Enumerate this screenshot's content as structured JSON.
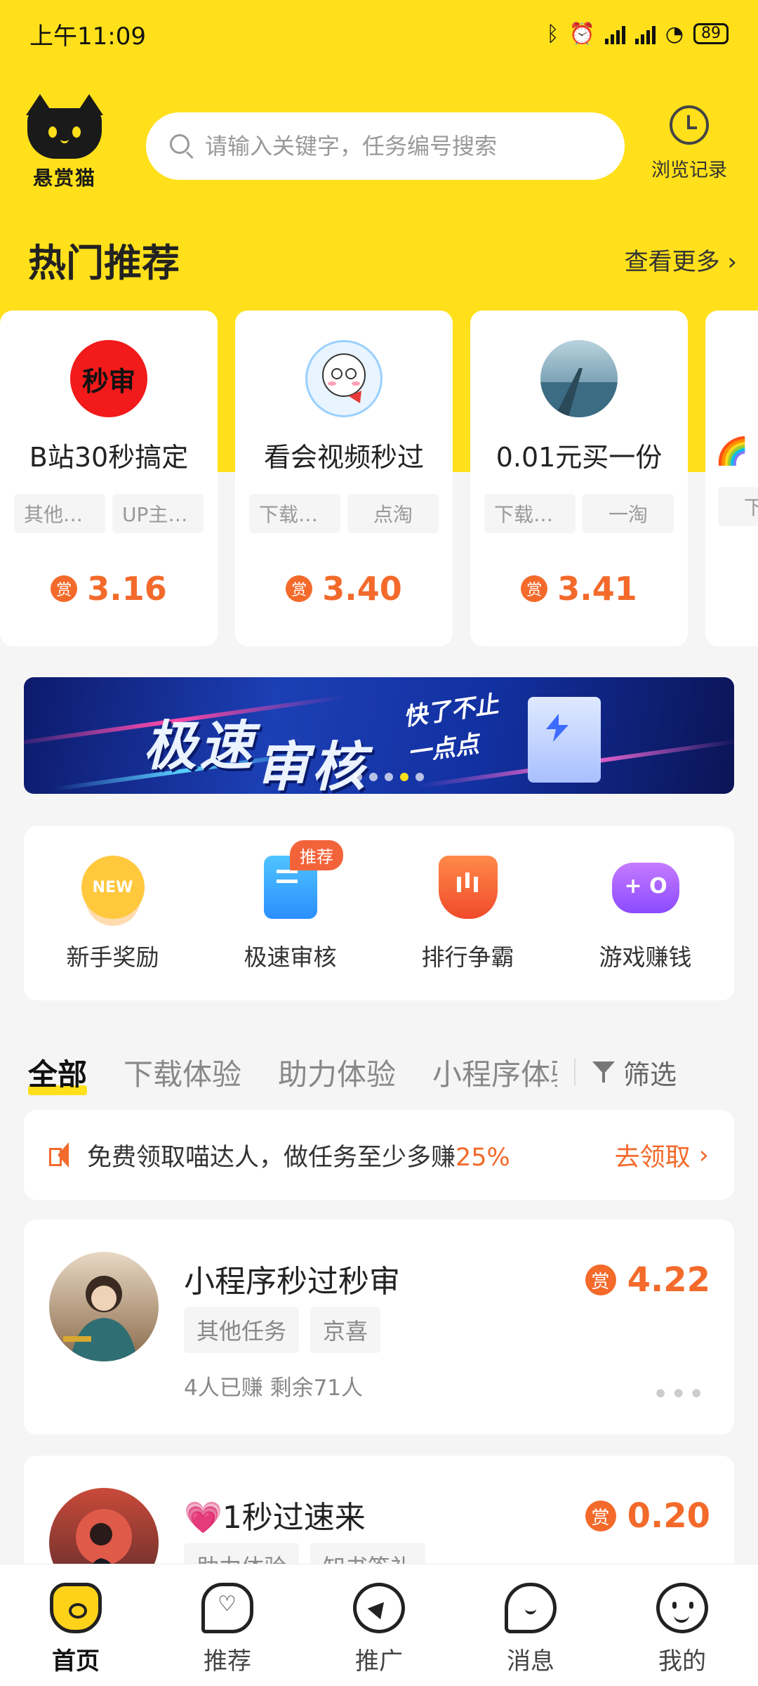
{
  "status": {
    "time": "上午11:09",
    "battery": "89"
  },
  "header": {
    "logo_name": "悬赏猫",
    "search_placeholder": "请输入关键字，任务编号搜索",
    "history_label": "浏览记录"
  },
  "hot": {
    "title": "热门推荐",
    "more_label": "查看更多",
    "cards": [
      {
        "avatar_text": "秒审",
        "avatar_color": "#f21a1a",
        "title": "B站30秒搞定",
        "tags": [
          "其他任务",
          "UP主任务"
        ],
        "reward_badge": "赏",
        "amount": "3.16"
      },
      {
        "avatar_text": "",
        "avatar_color": "#e8f4ff",
        "title": "看会视频秒过",
        "tags": [
          "下载体验",
          "点淘"
        ],
        "reward_badge": "赏",
        "amount": "3.40"
      },
      {
        "avatar_text": "",
        "avatar_color": "#5a8aa8",
        "title": "0.01元买一份",
        "tags": [
          "下载体验",
          "一淘"
        ],
        "reward_badge": "赏",
        "amount": "3.41"
      },
      {
        "avatar_text": "",
        "avatar_color": "#ffffff",
        "title": "🌈",
        "tags": [
          "下载"
        ],
        "reward_badge": "",
        "amount": ""
      }
    ]
  },
  "banner": {
    "line1": "极速",
    "line2": "审核",
    "slogan1": "快了不止",
    "slogan2": "一点点"
  },
  "quick": [
    {
      "label": "新手奖励",
      "icon_text": "NEW"
    },
    {
      "label": "极速审核",
      "badge": "推荐"
    },
    {
      "label": "排行争霸"
    },
    {
      "label": "游戏赚钱"
    }
  ],
  "tabs": {
    "items": [
      "全部",
      "下载体验",
      "助力体验",
      "小程序体验"
    ],
    "filter_label": "筛选"
  },
  "notice": {
    "message": "免费领取喵达人，做任务至少多赚",
    "percent": "25%",
    "action": "去领取"
  },
  "tasks": [
    {
      "title": "小程序秒过秒审",
      "tags": [
        "其他任务",
        "京喜"
      ],
      "stats": "4人已赚  剩余71人",
      "reward_badge": "赏",
      "amount": "4.22"
    },
    {
      "title": "💗1秒过速来",
      "tags": [
        "助力体验",
        "知书签礼"
      ],
      "stats": "",
      "reward_badge": "赏",
      "amount": "0.20"
    }
  ],
  "tabbar": {
    "items": [
      "首页",
      "推荐",
      "推广",
      "消息",
      "我的"
    ]
  },
  "colors": {
    "brand_yellow": "#ffe01b",
    "accent_orange": "#f36a2b"
  }
}
